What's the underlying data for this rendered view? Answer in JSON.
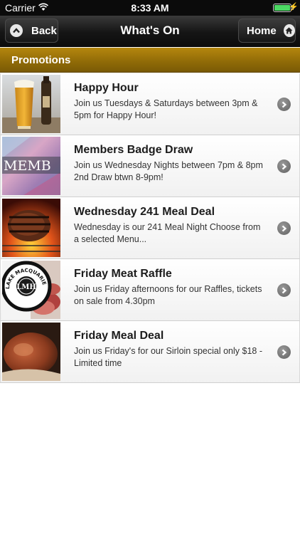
{
  "status_bar": {
    "carrier": "Carrier",
    "time": "8:33 AM",
    "battery_level": 1.0,
    "charging_glyph": "⚡"
  },
  "nav": {
    "back_label": "Back",
    "title": "What's On",
    "home_label": "Home"
  },
  "section": {
    "title": "Promotions"
  },
  "promotions": [
    {
      "title": "Happy Hour",
      "description": "Join us Tuesdays & Saturdays between 3pm & 5pm for Happy Hour!",
      "icon": "beer-glass-thumbnail"
    },
    {
      "title": "Members Badge Draw",
      "description": "Join us Wednesday Nights between 7pm & 8pm 2nd Draw btwn 8-9pm!",
      "thumb_text": "MEMB",
      "icon": "members-badge-thumbnail"
    },
    {
      "title": "Wednesday 241 Meal Deal",
      "description": "Wednesday is our 241 Meal Night Choose from a selected Menu...",
      "icon": "grill-steak-thumbnail"
    },
    {
      "title": "Friday Meat Raffle",
      "description": "Join us Friday afternoons for our Raffles, tickets on sale from 4.30pm",
      "thumb_text": "LAKE MACQUARIE",
      "thumb_logo": "LMH",
      "icon": "lmh-logo-thumbnail"
    },
    {
      "title": "Friday Meal Deal",
      "description": "Join us Friday's for our Sirloin special only $18 - Limited time",
      "icon": "sirloin-steak-thumbnail"
    }
  ],
  "colors": {
    "section_gold": "#9c7309",
    "nav_dark": "#151515",
    "battery_green": "#4cd964"
  }
}
